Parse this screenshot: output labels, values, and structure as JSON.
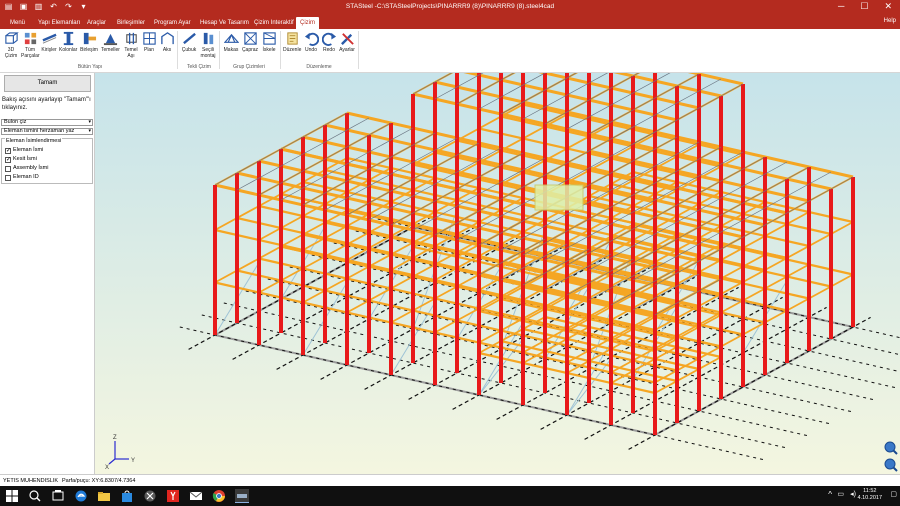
{
  "titlebar": {
    "title": "STASteel -C:\\STASteelProjects\\PINARRR9 (8)\\PINARRR9 (8).steel4cad",
    "minimize": "─",
    "maximize": "☐",
    "close": "✕"
  },
  "menu": {
    "tabs": [
      "Menü",
      "Yapı Elemanları",
      "Araçlar",
      "Birleşimler",
      "Program Ayar",
      "Hesap Ve Tasarım",
      "Çizim Interaktif",
      "Çizim"
    ],
    "active": "Çizim",
    "help": "Help"
  },
  "ribbon": {
    "groups": [
      {
        "label": "Bütün Yapı",
        "buttons": [
          "3D Çizim",
          "Tüm Parçalar",
          "Kirişler",
          "Kolonlar",
          "Birleşim",
          "Temeller",
          "Temel Aşı",
          "Plan",
          "Aks"
        ]
      },
      {
        "label": "Tekli Çizim",
        "buttons": [
          "Çubuk",
          "Seçili montaj"
        ]
      },
      {
        "label": "Grup Çizimleri",
        "buttons": [
          "Makas",
          "Çapraz",
          "İskele"
        ]
      },
      {
        "label": "Düzenleme",
        "buttons": [
          "Düzenle",
          "Undo",
          "Redo",
          "Ayarlar"
        ]
      }
    ]
  },
  "left_panel": {
    "ok_button": "Tamam",
    "hint": "Bakış açısını ayarlayıp \"Tamam\"'ı tıklayınız.",
    "bolt_select": "Bulon çiz",
    "name_select": "Eleman ismini herzaman yaz",
    "naming_group": {
      "legend": "Eleman İsimlendirmesi",
      "options": [
        {
          "label": "Eleman İsmi",
          "checked": true
        },
        {
          "label": "Kesit İsmi",
          "checked": true
        },
        {
          "label": "Assembly İsmi",
          "checked": false
        },
        {
          "label": "Eleman ID",
          "checked": false
        }
      ]
    }
  },
  "viewport": {
    "axes": {
      "z": "Z",
      "x": "X",
      "y": "Y"
    }
  },
  "status": {
    "company": "YETIS MUHENDISLIK",
    "coords": "Parfa/puçu: XY:6.8307/4.7364"
  },
  "taskbar": {
    "time": "11:52",
    "date": "4.10.2017"
  },
  "colors": {
    "brand": "#b42b1f",
    "column": "#e8191a",
    "beam": "#f5a623",
    "bracing": "#9ec3d6"
  }
}
